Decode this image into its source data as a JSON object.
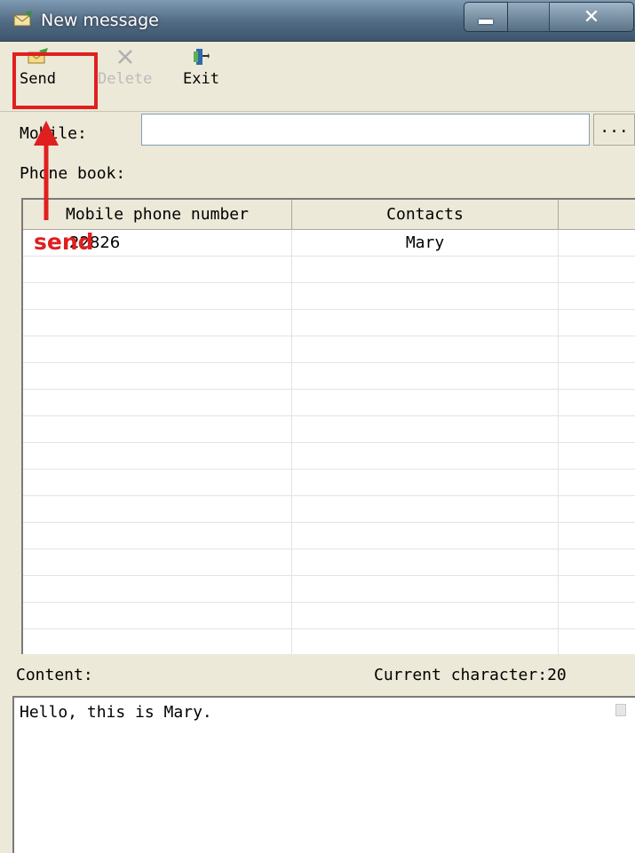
{
  "window": {
    "title": "New message"
  },
  "toolbar": {
    "send_label": "Send",
    "delete_label": "Delete",
    "exit_label": "Exit"
  },
  "mobile": {
    "label": "Mobile:",
    "value": "",
    "browse_label": "..."
  },
  "phone_book": {
    "label": "Phone book:",
    "columns": [
      "Mobile phone number",
      "Contacts",
      ""
    ],
    "rows": [
      {
        "number": "22826",
        "contact": "Mary"
      }
    ]
  },
  "content": {
    "label": "Content:",
    "char_count": "Current character:20",
    "text": "Hello, this is Mary."
  },
  "annotation": {
    "send_text": "send",
    "color": "#e01f1f"
  }
}
